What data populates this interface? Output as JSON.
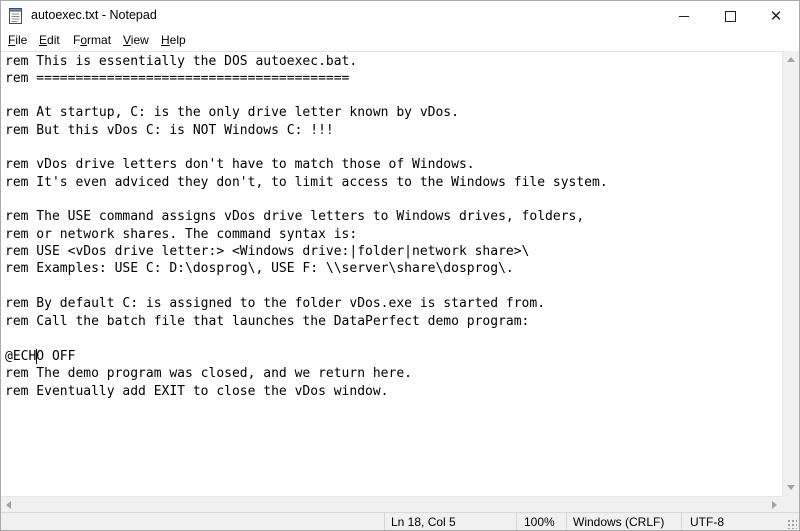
{
  "window": {
    "title": "autoexec.txt - Notepad",
    "icon": "notepad-icon"
  },
  "titlebar_buttons": {
    "minimize_icon": "minimize-icon",
    "maximize_icon": "maximize-icon",
    "close_icon": "close-icon",
    "close_glyph": "✕"
  },
  "menu": {
    "items": [
      {
        "mnemonic": "F",
        "rest": "ile"
      },
      {
        "mnemonic": "E",
        "rest": "dit"
      },
      {
        "pre": "F",
        "mnemonic": "o",
        "rest": "rmat"
      },
      {
        "mnemonic": "V",
        "rest": "iew"
      },
      {
        "mnemonic": "H",
        "rest": "elp"
      }
    ]
  },
  "editor": {
    "lines": [
      "rem This is essentially the DOS autoexec.bat.",
      "rem ========================================",
      "",
      "rem At startup, C: is the only drive letter known by vDos.",
      "rem But this vDos C: is NOT Windows C: !!!",
      "",
      "rem vDos drive letters don't have to match those of Windows.",
      "rem It's even adviced they don't, to limit access to the Windows file system.",
      "",
      "rem The USE command assigns vDos drive letters to Windows drives, folders,",
      "rem or network shares. The command syntax is:",
      "rem USE <vDos drive letter:> <Windows drive:|folder|network share>\\",
      "rem Examples: USE C: D:\\dosprog\\, USE F: \\\\server\\share\\dosprog\\.",
      "",
      "rem By default C: is assigned to the folder vDos.exe is started from.",
      "rem Call the batch file that launches the DataPerfect demo program:",
      "",
      "@ECHO OFF",
      "rem The demo program was closed, and we return here.",
      "rem Eventually add EXIT to close the vDos window."
    ]
  },
  "statusbar": {
    "position": "Ln 18, Col 5",
    "zoom": "100%",
    "line_ending": "Windows (CRLF)",
    "encoding": "UTF-8"
  }
}
